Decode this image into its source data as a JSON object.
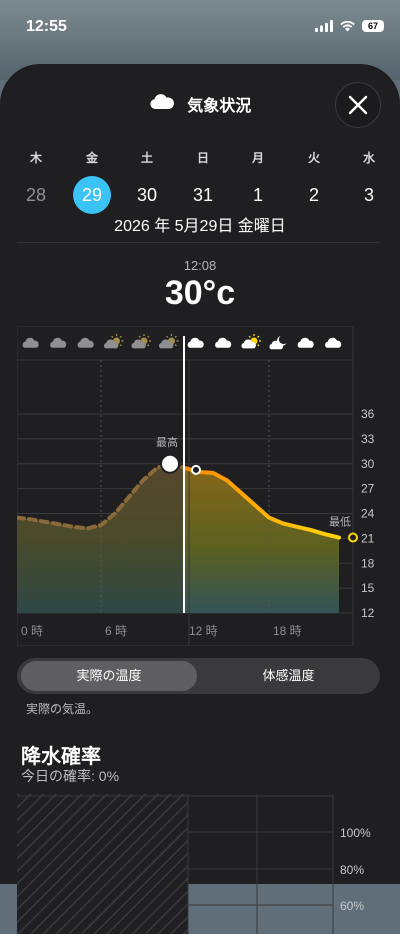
{
  "status_bar": {
    "time": "12:55",
    "battery": "67"
  },
  "header": {
    "title": "気象状況",
    "close_label": "close"
  },
  "days": [
    {
      "dow": "木",
      "num": "28",
      "state": "past"
    },
    {
      "dow": "金",
      "num": "29",
      "state": "selected"
    },
    {
      "dow": "土",
      "num": "30",
      "state": "future"
    },
    {
      "dow": "日",
      "num": "31",
      "state": "future"
    },
    {
      "dow": "月",
      "num": "1",
      "state": "future"
    },
    {
      "dow": "火",
      "num": "2",
      "state": "future"
    },
    {
      "dow": "水",
      "num": "3",
      "state": "future"
    }
  ],
  "selected_date": "2026 年 5月29日 金曜日",
  "current": {
    "time": "12:08",
    "temp": "30°c"
  },
  "chart_data": {
    "type": "area",
    "x": [
      0,
      1,
      2,
      3,
      4,
      5,
      6,
      7,
      8,
      9,
      10,
      11,
      12,
      13,
      14,
      15,
      16,
      17,
      18,
      19,
      20,
      21,
      22,
      23
    ],
    "y_actual": [
      23.5,
      23.3,
      23.0,
      22.7,
      22.4,
      22.2,
      22.6,
      24.0,
      26.0,
      28.0,
      29.5,
      30.0,
      29.5,
      29.0,
      28.9,
      28.0,
      26.5,
      25.0,
      23.5,
      22.8,
      22.4,
      22.0,
      21.5,
      21.1
    ],
    "ylim": [
      12,
      36
    ],
    "y_ticks": [
      "36",
      "33",
      "30",
      "27",
      "24",
      "21",
      "18",
      "15",
      "12"
    ],
    "x_ticks": [
      "0 時",
      "6 時",
      "12 時",
      "18 時"
    ],
    "annotations": {
      "max_label": "最高",
      "min_label": "最低"
    },
    "now_hour": 12.0,
    "weather_icons": [
      "cloud",
      "cloud",
      "cloud",
      "partly-sunny",
      "partly-sunny",
      "partly-sunny",
      "cloud-white",
      "cloud-white",
      "partly-sunny",
      "moon-cloud",
      "cloud-white",
      "cloud-white"
    ]
  },
  "segmented": {
    "options": [
      "実際の温度",
      "体感温度"
    ],
    "active": "実際の温度"
  },
  "note": "実際の気温。",
  "precip": {
    "title": "降水確率",
    "subtitle": "今日の確率: 0%",
    "y_ticks": [
      "100%",
      "80%",
      "60%"
    ]
  },
  "colors": {
    "accent": "#3cc3f5",
    "curve_hot": "#ff9f0a",
    "curve_cool": "#ffd60a",
    "background": "#1f1f21"
  }
}
